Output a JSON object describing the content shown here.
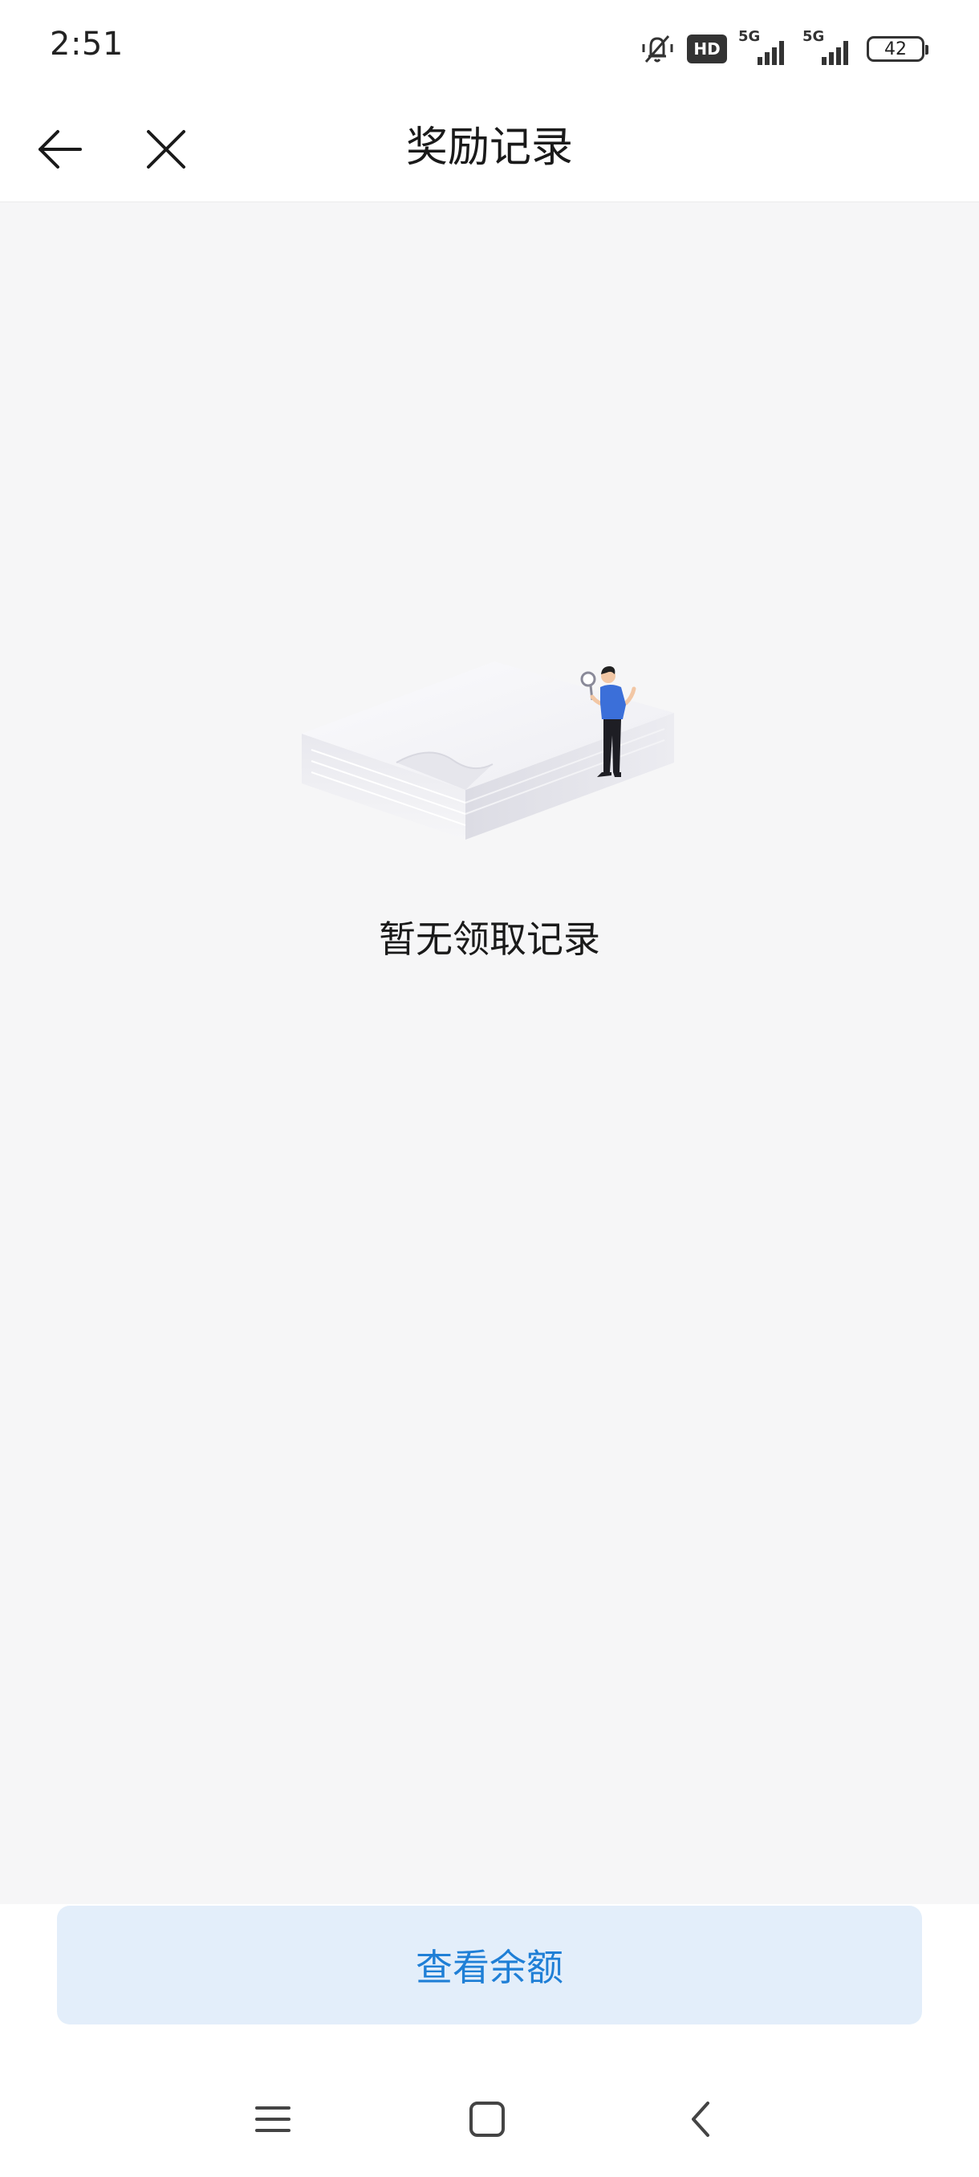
{
  "status_bar": {
    "time": "2:51",
    "hd_label": "HD",
    "signal_1_label": "5G",
    "signal_2_label": "5G",
    "battery_level": "42",
    "icons": [
      "mute-icon",
      "hd-icon",
      "signal-5g-icon",
      "signal-5g-icon",
      "battery-icon"
    ]
  },
  "header": {
    "title": "奖励记录",
    "back_icon": "arrow-left-icon",
    "close_icon": "close-icon"
  },
  "main": {
    "empty_message": "暂无领取记录",
    "illustration": "empty-records-illustration"
  },
  "footer": {
    "balance_button_label": "查看余额"
  },
  "system_nav": {
    "icons": [
      "menu-icon",
      "home-icon",
      "back-icon"
    ]
  },
  "colors": {
    "accent": "#1f7fd6",
    "button_bg": "#e3eefa",
    "content_bg": "#f6f6f7",
    "figure_shirt": "#3b6fd9"
  }
}
